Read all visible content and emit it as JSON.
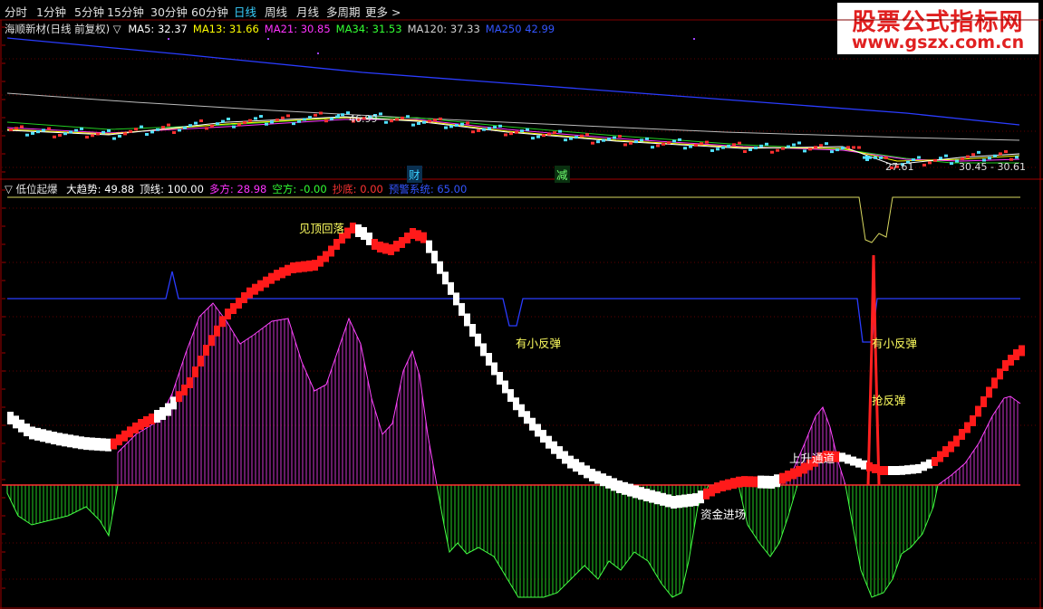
{
  "toolbar": {
    "items": [
      "分时",
      "1分钟",
      "5分钟",
      "15分钟",
      "30分钟",
      "60分钟",
      "日线",
      "周线",
      "月线",
      "多周期",
      "更多 >"
    ],
    "active": "日线"
  },
  "logo": {
    "line1": "股票公式指标网",
    "line2": "www.gszx.com.cn"
  },
  "main_chart": {
    "stock_title": "海顺新材(日线 前复权)",
    "toggle_icon": "▽",
    "ma": [
      {
        "label": "MA5:",
        "value": "32.37",
        "color": "#ffffff"
      },
      {
        "label": "MA13:",
        "value": "31.66",
        "color": "#ffff00"
      },
      {
        "label": "MA21:",
        "value": "30.85",
        "color": "#ff33ff"
      },
      {
        "label": "MA34:",
        "value": "31.53",
        "color": "#33ff33"
      },
      {
        "label": "MA120:",
        "value": "37.33",
        "color": "#d0d0d0"
      },
      {
        "label": "MA250",
        "value": "42.99",
        "color": "#3355ff"
      }
    ],
    "price_labels": {
      "high": "46.99",
      "low": "27.61",
      "range": "30.45 - 30.61"
    },
    "event_markers": [
      "财",
      "减"
    ]
  },
  "indicator": {
    "toggle_icon": "▽",
    "name": "低位起爆",
    "values": [
      {
        "label": "大趋势:",
        "value": "49.88",
        "color": "#ffffff"
      },
      {
        "label": "顶线:",
        "value": "100.00",
        "color": "#ffffff"
      },
      {
        "label": "多方:",
        "value": "28.98",
        "color": "#ff33ff"
      },
      {
        "label": "空方:",
        "value": "-0.00",
        "color": "#33ff33"
      },
      {
        "label": "抄底:",
        "value": "0.00",
        "color": "#ff3333"
      },
      {
        "label": "预警系统:",
        "value": "65.00",
        "color": "#3355ff"
      }
    ],
    "annotations": {
      "top_reversal": "见顶回落",
      "small_rebound_1": "有小反弹",
      "small_rebound_2": "有小反弹",
      "grab_rebound": "抢反弹",
      "rising_channel": "上升通道",
      "capital_entry": "资金进场"
    }
  }
}
